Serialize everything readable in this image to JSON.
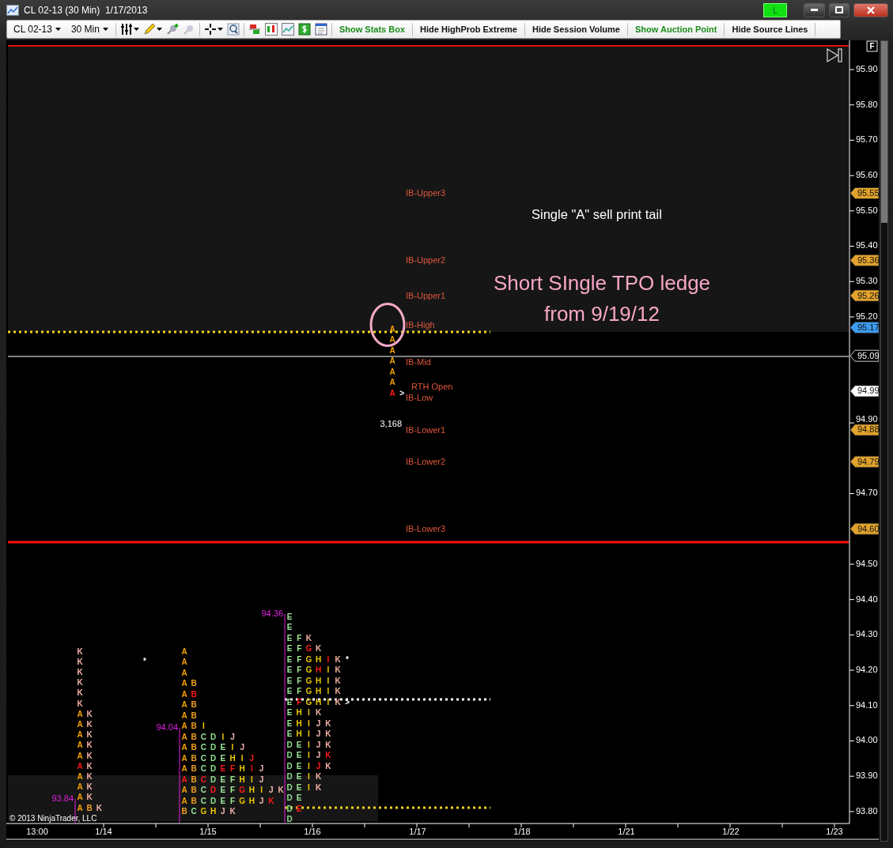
{
  "window": {
    "title": "CL 02-13 (30 Min)  1/17/2013",
    "status_badge": "L"
  },
  "toolbar": {
    "instrument": "CL 02-13",
    "interval": "30 Min",
    "buttons": [
      {
        "label": "Show Stats Box",
        "highlighted": true
      },
      {
        "label": "Hide HighProb Extreme",
        "highlighted": false
      },
      {
        "label": "Hide Session Volume",
        "highlighted": false
      },
      {
        "label": "Show Auction Point",
        "highlighted": true
      },
      {
        "label": "Hide Source Lines",
        "highlighted": false
      }
    ]
  },
  "chart": {
    "corner_button": "F",
    "annotations": {
      "note": "Single \"A\" sell print tail",
      "callout": [
        "Short SIngle TPO ledge",
        "from 9/19/12"
      ]
    },
    "ib_levels": [
      "IB-Upper3",
      "IB-Upper2",
      "IB-Upper1",
      "IB-High",
      "IB-Mid",
      "IB-Low",
      "IB-Lower1",
      "IB-Lower2",
      "IB-Lower3"
    ],
    "rth_open": "RTH Open",
    "volume": "3,168",
    "stray_marks": [
      "*",
      "*"
    ],
    "tpo_profiles": [
      {
        "high_label": "93.84",
        "rows": [
          [
            {
              "letter": "K",
              "highlight": false
            }
          ],
          [
            {
              "letter": "K",
              "highlight": false
            }
          ],
          [
            {
              "letter": "K",
              "highlight": false
            }
          ],
          [
            {
              "letter": "K",
              "highlight": false
            }
          ],
          [
            {
              "letter": "K",
              "highlight": false
            }
          ],
          [
            {
              "letter": "K",
              "highlight": false
            }
          ],
          [
            {
              "letter": "A",
              "highlight": false
            },
            {
              "letter": "K",
              "highlight": false
            }
          ],
          [
            {
              "letter": "A",
              "highlight": false
            },
            {
              "letter": "K",
              "highlight": false
            }
          ],
          [
            {
              "letter": "A",
              "highlight": false
            },
            {
              "letter": "K",
              "highlight": false
            }
          ],
          [
            {
              "letter": "A",
              "highlight": false
            },
            {
              "letter": "K",
              "highlight": false
            }
          ],
          [
            {
              "letter": "A",
              "highlight": false
            },
            {
              "letter": "K",
              "highlight": false
            }
          ],
          [
            {
              "letter": "A",
              "highlight": true
            },
            {
              "letter": "K",
              "highlight": false
            }
          ],
          [
            {
              "letter": "A",
              "highlight": false
            },
            {
              "letter": "K",
              "highlight": false
            }
          ],
          [
            {
              "letter": "A",
              "highlight": false
            },
            {
              "letter": "K",
              "highlight": false
            }
          ],
          [
            {
              "letter": "A",
              "highlight": false
            },
            {
              "letter": "K",
              "highlight": false
            }
          ],
          [
            {
              "letter": "A",
              "highlight": false
            },
            {
              "letter": "B",
              "highlight": false
            },
            {
              "letter": "K",
              "highlight": false
            }
          ]
        ]
      },
      {
        "high_label": "94.04",
        "rows": [
          [
            {
              "letter": "A",
              "highlight": false
            }
          ],
          [
            {
              "letter": "A",
              "highlight": false
            }
          ],
          [
            {
              "letter": "A",
              "highlight": false
            }
          ],
          [
            {
              "letter": "A",
              "highlight": false
            },
            {
              "letter": "B",
              "highlight": false
            }
          ],
          [
            {
              "letter": "A",
              "highlight": false
            },
            {
              "letter": "B",
              "highlight": true
            }
          ],
          [
            {
              "letter": "A",
              "highlight": false
            },
            {
              "letter": "B",
              "highlight": false
            }
          ],
          [
            {
              "letter": "A",
              "highlight": false
            },
            {
              "letter": "B",
              "highlight": false
            }
          ],
          [
            {
              "letter": "A",
              "highlight": false
            },
            {
              "letter": "B",
              "highlight": false
            },
            {
              "letter": "I",
              "highlight": false
            }
          ],
          [
            {
              "letter": "A",
              "highlight": false
            },
            {
              "letter": "B",
              "highlight": false
            },
            {
              "letter": "C",
              "highlight": false
            },
            {
              "letter": "D",
              "highlight": false
            },
            {
              "letter": "I",
              "highlight": false
            },
            {
              "letter": "J",
              "highlight": false
            }
          ],
          [
            {
              "letter": "A",
              "highlight": false
            },
            {
              "letter": "B",
              "highlight": false
            },
            {
              "letter": "C",
              "highlight": false
            },
            {
              "letter": "D",
              "highlight": false
            },
            {
              "letter": "E",
              "highlight": false
            },
            {
              "letter": "I",
              "highlight": false
            },
            {
              "letter": "J",
              "highlight": false
            }
          ],
          [
            {
              "letter": "A",
              "highlight": false
            },
            {
              "letter": "B",
              "highlight": false
            },
            {
              "letter": "C",
              "highlight": false
            },
            {
              "letter": "D",
              "highlight": false
            },
            {
              "letter": "E",
              "highlight": false
            },
            {
              "letter": "H",
              "highlight": false
            },
            {
              "letter": "I",
              "highlight": false
            },
            {
              "letter": "J",
              "highlight": true
            }
          ],
          [
            {
              "letter": "A",
              "highlight": false
            },
            {
              "letter": "B",
              "highlight": false
            },
            {
              "letter": "C",
              "highlight": false
            },
            {
              "letter": "D",
              "highlight": false
            },
            {
              "letter": "E",
              "highlight": true
            },
            {
              "letter": "F",
              "highlight": true
            },
            {
              "letter": "H",
              "highlight": false
            },
            {
              "letter": "I",
              "highlight": true
            },
            {
              "letter": "J",
              "highlight": false
            }
          ],
          [
            {
              "letter": "A",
              "highlight": true
            },
            {
              "letter": "B",
              "highlight": false
            },
            {
              "letter": "C",
              "highlight": true
            },
            {
              "letter": "D",
              "highlight": false
            },
            {
              "letter": "E",
              "highlight": false
            },
            {
              "letter": "F",
              "highlight": false
            },
            {
              "letter": "H",
              "highlight": false
            },
            {
              "letter": "I",
              "highlight": false
            },
            {
              "letter": "J",
              "highlight": false
            }
          ],
          [
            {
              "letter": "A",
              "highlight": false
            },
            {
              "letter": "B",
              "highlight": false
            },
            {
              "letter": "C",
              "highlight": false
            },
            {
              "letter": "D",
              "highlight": true
            },
            {
              "letter": "E",
              "highlight": false
            },
            {
              "letter": "F",
              "highlight": false
            },
            {
              "letter": "G",
              "highlight": true
            },
            {
              "letter": "H",
              "highlight": false
            },
            {
              "letter": "I",
              "highlight": false
            },
            {
              "letter": "J",
              "highlight": false
            },
            {
              "letter": "K",
              "highlight": false
            }
          ],
          [
            {
              "letter": "A",
              "highlight": false
            },
            {
              "letter": "B",
              "highlight": false
            },
            {
              "letter": "C",
              "highlight": false
            },
            {
              "letter": "D",
              "highlight": false
            },
            {
              "letter": "E",
              "highlight": false
            },
            {
              "letter": "F",
              "highlight": false
            },
            {
              "letter": "G",
              "highlight": false
            },
            {
              "letter": "H",
              "highlight": false
            },
            {
              "letter": "J",
              "highlight": false
            },
            {
              "letter": "K",
              "highlight": true
            }
          ],
          [
            {
              "letter": "B",
              "highlight": false
            },
            {
              "letter": "C",
              "highlight": false
            },
            {
              "letter": "G",
              "highlight": false
            },
            {
              "letter": "H",
              "highlight": false
            },
            {
              "letter": "J",
              "highlight": false
            },
            {
              "letter": "K",
              "highlight": false
            }
          ]
        ]
      },
      {
        "high_label": "94.36",
        "rows": [
          [
            {
              "letter": "E",
              "highlight": false
            }
          ],
          [
            {
              "letter": "E",
              "highlight": false
            }
          ],
          [
            {
              "letter": "E",
              "highlight": false
            },
            {
              "letter": "F",
              "highlight": false
            },
            {
              "letter": "K",
              "highlight": false
            }
          ],
          [
            {
              "letter": "E",
              "highlight": false
            },
            {
              "letter": "F",
              "highlight": false
            },
            {
              "letter": "G",
              "highlight": true
            },
            {
              "letter": "K",
              "highlight": false
            }
          ],
          [
            {
              "letter": "E",
              "highlight": false
            },
            {
              "letter": "F",
              "highlight": false
            },
            {
              "letter": "G",
              "highlight": false
            },
            {
              "letter": "H",
              "highlight": false
            },
            {
              "letter": "I",
              "highlight": true
            },
            {
              "letter": "K",
              "highlight": false
            }
          ],
          [
            {
              "letter": "E",
              "highlight": false
            },
            {
              "letter": "F",
              "highlight": false
            },
            {
              "letter": "G",
              "highlight": false
            },
            {
              "letter": "H",
              "highlight": true
            },
            {
              "letter": "I",
              "highlight": false
            },
            {
              "letter": "K",
              "highlight": false
            }
          ],
          [
            {
              "letter": "E",
              "highlight": false
            },
            {
              "letter": "F",
              "highlight": false
            },
            {
              "letter": "G",
              "highlight": false
            },
            {
              "letter": "H",
              "highlight": false
            },
            {
              "letter": "I",
              "highlight": false
            },
            {
              "letter": "K",
              "highlight": false
            }
          ],
          [
            {
              "letter": "E",
              "highlight": false
            },
            {
              "letter": "F",
              "highlight": false
            },
            {
              "letter": "G",
              "highlight": false
            },
            {
              "letter": "H",
              "highlight": false
            },
            {
              "letter": "I",
              "highlight": false
            },
            {
              "letter": "K",
              "highlight": false
            }
          ],
          [
            {
              "letter": "E",
              "highlight": false
            },
            {
              "letter": "F",
              "highlight": true
            },
            {
              "letter": "G",
              "highlight": false
            },
            {
              "letter": "H",
              "highlight": false
            },
            {
              "letter": "I",
              "highlight": false
            },
            {
              "letter": "K",
              "highlight": false
            },
            {
              "letter": ">",
              "highlight": false
            }
          ],
          [
            {
              "letter": "E",
              "highlight": false
            },
            {
              "letter": "H",
              "highlight": false
            },
            {
              "letter": "I",
              "highlight": false
            },
            {
              "letter": "K",
              "highlight": false
            }
          ],
          [
            {
              "letter": "E",
              "highlight": false
            },
            {
              "letter": "H",
              "highlight": false
            },
            {
              "letter": "I",
              "highlight": false
            },
            {
              "letter": "J",
              "highlight": false
            },
            {
              "letter": "K",
              "highlight": false
            }
          ],
          [
            {
              "letter": "E",
              "highlight": false
            },
            {
              "letter": "H",
              "highlight": false
            },
            {
              "letter": "I",
              "highlight": false
            },
            {
              "letter": "J",
              "highlight": false
            },
            {
              "letter": "K",
              "highlight": false
            }
          ],
          [
            {
              "letter": "D",
              "highlight": false
            },
            {
              "letter": "E",
              "highlight": false
            },
            {
              "letter": "I",
              "highlight": false
            },
            {
              "letter": "J",
              "highlight": false
            },
            {
              "letter": "K",
              "highlight": false
            }
          ],
          [
            {
              "letter": "D",
              "highlight": false
            },
            {
              "letter": "E",
              "highlight": false
            },
            {
              "letter": "I",
              "highlight": false
            },
            {
              "letter": "J",
              "highlight": false
            },
            {
              "letter": "K",
              "highlight": true
            }
          ],
          [
            {
              "letter": "D",
              "highlight": false
            },
            {
              "letter": "E",
              "highlight": false
            },
            {
              "letter": "I",
              "highlight": false
            },
            {
              "letter": "J",
              "highlight": true
            },
            {
              "letter": "K",
              "highlight": false
            }
          ],
          [
            {
              "letter": "D",
              "highlight": false
            },
            {
              "letter": "E",
              "highlight": false
            },
            {
              "letter": "I",
              "highlight": false
            },
            {
              "letter": "K",
              "highlight": false
            }
          ],
          [
            {
              "letter": "D",
              "highlight": false
            },
            {
              "letter": "E",
              "highlight": false
            },
            {
              "letter": "I",
              "highlight": false
            },
            {
              "letter": "K",
              "highlight": false
            }
          ],
          [
            {
              "letter": "D",
              "highlight": false
            },
            {
              "letter": "E",
              "highlight": false
            }
          ],
          [
            {
              "letter": "D",
              "highlight": false
            },
            {
              "letter": "E",
              "highlight": true
            }
          ],
          [
            {
              "letter": "D",
              "highlight": false
            }
          ]
        ]
      },
      {
        "rows": [
          [
            {
              "letter": "A",
              "highlight": false
            }
          ],
          [
            {
              "letter": "A",
              "highlight": false
            }
          ],
          [
            {
              "letter": "A",
              "highlight": false
            }
          ],
          [
            {
              "letter": "A",
              "highlight": false
            }
          ],
          [
            {
              "letter": "A",
              "highlight": false
            }
          ],
          [
            {
              "letter": "A",
              "highlight": false
            }
          ],
          [
            {
              "letter": "A",
              "highlight": true
            },
            {
              "letter": ">",
              "highlight": false
            }
          ]
        ]
      }
    ],
    "price_ticks": [
      "95.90",
      "95.80",
      "95.70",
      "95.60",
      "95.50",
      "95.40",
      "95.30",
      "95.20",
      "94.90",
      "94.70",
      "94.50",
      "94.40",
      "94.30",
      "94.20",
      "94.10",
      "94.00",
      "93.90",
      "93.80"
    ],
    "price_markers": [
      {
        "text": "95.55",
        "color": "#e2a32c"
      },
      {
        "text": "95.36",
        "color": "#e2a32c"
      },
      {
        "text": "95.26",
        "color": "#e2a32c"
      },
      {
        "text": "95.17",
        "color": "#3d9cf2"
      },
      {
        "text": "95.09",
        "color": "#000000"
      },
      {
        "text": "94.99",
        "color": "#ffffff"
      },
      {
        "text": "94.88",
        "color": "#e2a32c"
      },
      {
        "text": "94.79",
        "color": "#e2a32c"
      },
      {
        "text": "94.60",
        "color": "#e2a32c"
      }
    ],
    "time_labels": [
      "13:00",
      "1/14",
      "1/15",
      "1/16",
      "1/17",
      "1/18",
      "1/21",
      "1/22",
      "1/23"
    ],
    "copyright": "© 2013 NinjaTrader, LLC"
  }
}
